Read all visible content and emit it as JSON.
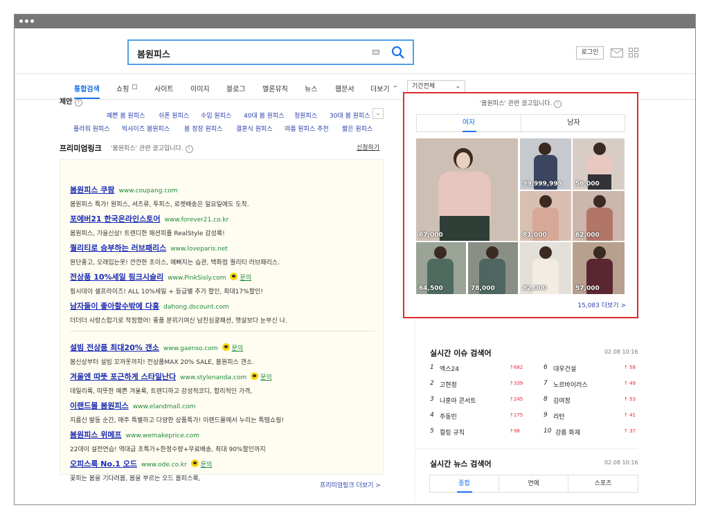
{
  "search": {
    "query": "봄원피스"
  },
  "header": {
    "login_label": "로그인"
  },
  "nav": {
    "items": [
      "통합검색",
      "쇼핑",
      "사이트",
      "이미지",
      "블로그",
      "멜론뮤직",
      "뉴스",
      "웹문서",
      "더보기"
    ],
    "period_label": "기간전체"
  },
  "suggestions": {
    "label": "제안",
    "row1": [
      "예쁜 봄 원피스",
      "쉬폰 원피스",
      "수입 원피스",
      "40대 봄 원피스",
      "청원피스",
      "30대 봄 원피스"
    ],
    "row2": [
      "플라워 원피스",
      "빅사이즈 봄원피스",
      "봄 정장 원피스",
      "결혼식 원피스",
      "여름 원피스 추천",
      "짧은 원피스"
    ]
  },
  "premium": {
    "title": "프리미엄링크",
    "subtitle": "'봄원피스' 관련 광고입니다.",
    "apply_label": "신청하기",
    "more_label": "프리미엄링크 더보기 >",
    "inquiry_label": "문의",
    "ads": [
      {
        "title": "봄원피스 쿠팡",
        "url": "www.coupang.com",
        "desc": "봄원피스 특가! 원피스, 셔츠류, 투피스, 로켓배송은 일요일에도 도착."
      },
      {
        "title": "포에버21 한국온라인스토어",
        "url": "www.forever21.co.kr",
        "desc": "봄원피스, 가을신상! 트렌디한 패션피플 RealStyle 감성룩!"
      },
      {
        "title": "퀄리티로 승부하는 러브패리스",
        "url": "www.loveparis.net",
        "desc": "원단좋고, 오래입는옷! 깐깐한 초이스, 예뻐지는 습관, 백화점 퀄리티 러브패리스."
      },
      {
        "title": "전상품 10%세일 핑크시슬리",
        "url": "www.PinkSisly.com",
        "desc": "핑시데이 셀프라이즈! ALL 10%세일 + 등급별 추가 할인, 최대17%할인!"
      },
      {
        "title": "남자들이 좋아할수밖에 다홍",
        "url": "dahong.dscount.com",
        "desc": "더더더 사랑스럽기로 작정했어! 좋품 분위기여신 남친심쿵패션, 햇살보다 눈부신 나."
      },
      {
        "title": "설빔 전상품 최대20% 갠소",
        "url": "www.gaenso.com",
        "desc": "봄신상부터 설빔 꼬까옷까지! 전상품MAX 20% SALE, 봄원피스 갠소."
      },
      {
        "title": "겨울엔 따뜻 포근하게 스타일난다",
        "url": "www.stylenanda.com",
        "desc": "데일리룩, 따뜻한 예쁜 겨울룩, 트렌디하고 감성적코디, 합리적인 가격,"
      },
      {
        "title": "이랜드몰 봄원피스",
        "url": "www.elandmall.com",
        "desc": "지름신 발동 순간, 매주 특별하고 다양한 상품특가! 이랜드몰에서 누리는 특템쇼핑!"
      },
      {
        "title": "봄원피스 위메프",
        "url": "www.wemakeprice.com",
        "desc": "22데이 설전연습! 역대급 초특가+한정수량+무료배송, 최대 90%할인까지"
      },
      {
        "title": "오피스룩 No.1 오드",
        "url": "www.ode.co.kr",
        "desc": "꽃피는 봄을 기다려봄, 봄을 부르는 오드 봄피스룩,"
      }
    ]
  },
  "shopping": {
    "note": "'봄원피스' 관련 광고입니다.",
    "tabs": [
      "여자",
      "남자"
    ],
    "prices": [
      "67,000",
      "99,999,999",
      "56,000",
      "81,000",
      "62,000",
      "64,500",
      "78,000",
      "82,000",
      "57,000"
    ],
    "more_label": "15,083 더보기 >"
  },
  "realtime": {
    "title": "실시간 이슈 검색어",
    "time": "02.08  10:16",
    "items": [
      {
        "rank": "1",
        "word": "엑스24",
        "change": "682"
      },
      {
        "rank": "2",
        "word": "고현정",
        "change": "339"
      },
      {
        "rank": "3",
        "word": "나훈아 콘서트",
        "change": "245"
      },
      {
        "rank": "4",
        "word": "주동민",
        "change": "175"
      },
      {
        "rank": "5",
        "word": "컬링 규칙",
        "change": "98"
      },
      {
        "rank": "6",
        "word": "대우건설",
        "change": "58"
      },
      {
        "rank": "7",
        "word": "노르바이러스",
        "change": "49"
      },
      {
        "rank": "8",
        "word": "김여정",
        "change": "53"
      },
      {
        "rank": "9",
        "word": "리턴",
        "change": "41"
      },
      {
        "rank": "10",
        "word": "강릉 화재",
        "change": "37"
      }
    ]
  },
  "news": {
    "title": "실시간 뉴스 검색어",
    "time": "02.08  10:16",
    "tabs": [
      "종합",
      "연예",
      "스포츠"
    ]
  }
}
